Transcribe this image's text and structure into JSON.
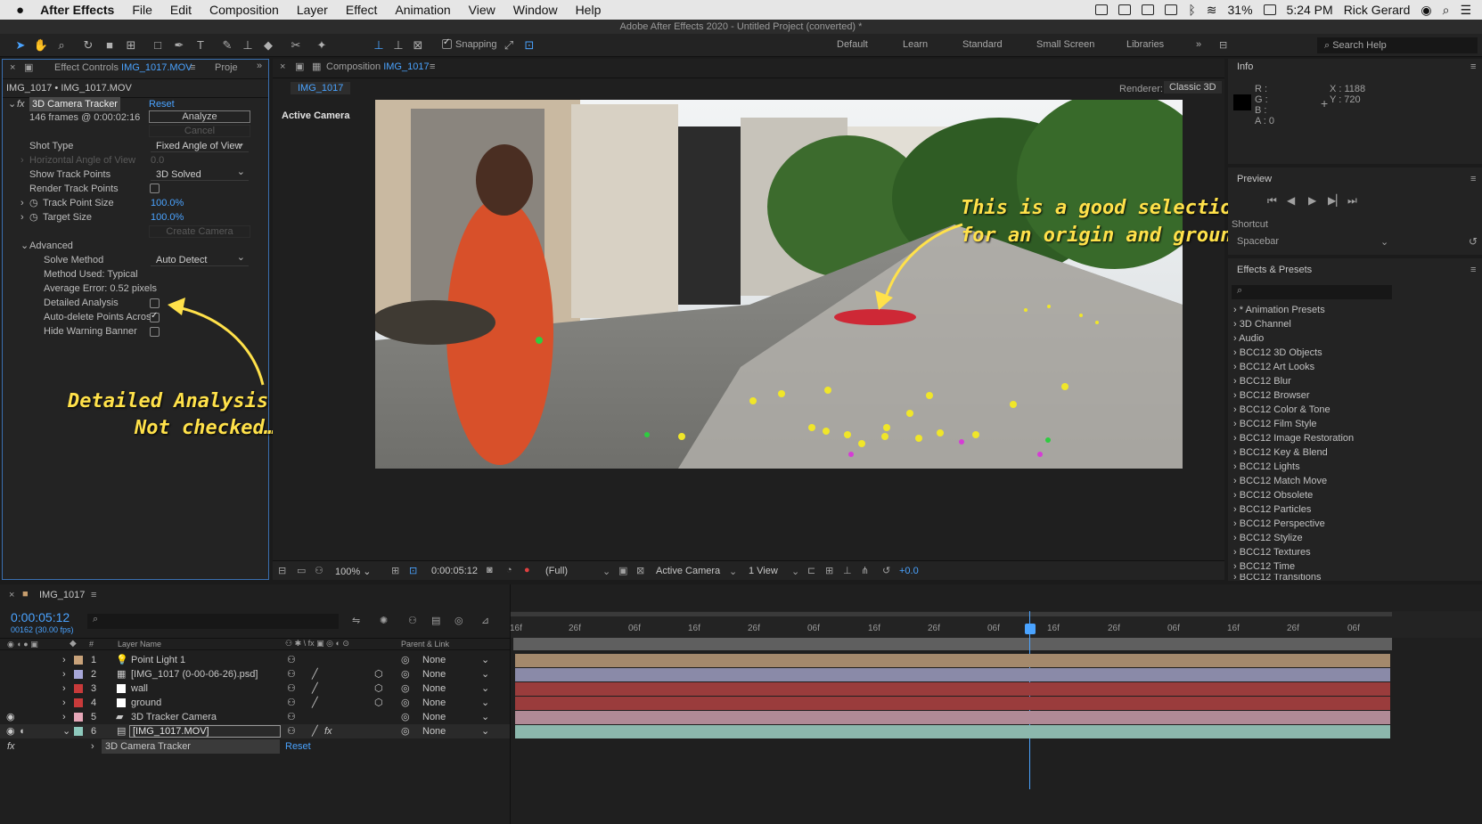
{
  "menubar": {
    "app": "After Effects",
    "items": [
      "File",
      "Edit",
      "Composition",
      "Layer",
      "Effect",
      "Animation",
      "View",
      "Window",
      "Help"
    ],
    "battery": "31%",
    "time": "5:24 PM",
    "user": "Rick Gerard"
  },
  "window_title": "Adobe After Effects 2020 - Untitled Project (converted) *",
  "toolbar": {
    "snapping": "Snapping",
    "workspaces": [
      "Default",
      "Learn",
      "Standard",
      "Small Screen",
      "Libraries"
    ],
    "search_placeholder": "Search Help"
  },
  "effect_controls": {
    "tab_prefix": "Effect Controls",
    "tab_file": "IMG_1017.MOV",
    "tab2": "Proje",
    "header": "IMG_1017 • IMG_1017.MOV",
    "effect_name": "3D Camera Tracker",
    "reset": "Reset",
    "frames_info": "146 frames @ 0:00:02:16",
    "analyze": "Analyze",
    "cancel": "Cancel",
    "shot_type_label": "Shot Type",
    "shot_type_value": "Fixed Angle of View",
    "hav_label": "Horizontal Angle of View",
    "hav_value": "0.0",
    "show_tp_label": "Show Track Points",
    "show_tp_value": "3D Solved",
    "render_tp_label": "Render Track Points",
    "tp_size_label": "Track Point Size",
    "tp_size_value": "100.0%",
    "target_size_label": "Target Size",
    "target_size_value": "100.0%",
    "create_camera": "Create Camera",
    "advanced_label": "Advanced",
    "solve_method_label": "Solve Method",
    "solve_method_value": "Auto Detect",
    "method_used": "Method Used: Typical",
    "avg_error": "Average Error: 0.52 pixels",
    "detailed_label": "Detailed Analysis",
    "autodelete_label": "Auto-delete Points Acros",
    "hide_warning_label": "Hide Warning Banner"
  },
  "composition": {
    "tab_prefix": "Composition",
    "tab_name": "IMG_1017",
    "subtab": "IMG_1017",
    "renderer_label": "Renderer:",
    "renderer_value": "Classic 3D",
    "view_label": "Active Camera",
    "zoom": "100%",
    "timecode": "0:00:05:12",
    "resolution": "(Full)",
    "camera": "Active Camera",
    "views": "1 View",
    "exposure": "+0.0"
  },
  "annotations": {
    "left_line1": "Detailed Analysis",
    "left_line2": "Not checked…",
    "right_line1": "This is a good selection",
    "right_line2": "for an origin and ground plane"
  },
  "info": {
    "title": "Info",
    "r": "R :",
    "g": "G :",
    "b": "B :",
    "a": "A : 0",
    "x": "X : 1188",
    "y": "Y : 720"
  },
  "preview": {
    "title": "Preview",
    "shortcut_label": "Shortcut",
    "shortcut_value": "Spacebar"
  },
  "effects_presets": {
    "title": "Effects & Presets",
    "items": [
      "* Animation Presets",
      "3D Channel",
      "Audio",
      "BCC12 3D Objects",
      "BCC12 Art Looks",
      "BCC12 Blur",
      "BCC12 Browser",
      "BCC12 Color & Tone",
      "BCC12 Film Style",
      "BCC12 Image Restoration",
      "BCC12 Key & Blend",
      "BCC12 Lights",
      "BCC12 Match Move",
      "BCC12 Obsolete",
      "BCC12 Particles",
      "BCC12 Perspective",
      "BCC12 Stylize",
      "BCC12 Textures",
      "BCC12 Time",
      "BCC12 Transitions"
    ]
  },
  "timeline": {
    "tab": "IMG_1017",
    "timecode": "0:00:05:12",
    "fps": "00162 (30.00 fps)",
    "col_num": "#",
    "col_name": "Layer Name",
    "col_parent": "Parent & Link",
    "ruler": [
      "16f",
      "26f",
      "06f",
      "16f",
      "26f",
      "06f",
      "16f",
      "26f",
      "06f",
      "16f",
      "26f",
      "06f",
      "16f",
      "26f",
      "06f"
    ],
    "layers": [
      {
        "num": "1",
        "name": "Point Light 1",
        "parent": "None",
        "color": "#c8a27a"
      },
      {
        "num": "2",
        "name": "[IMG_1017 (0-00-06-26).psd]",
        "parent": "None",
        "color": "#a7a7d8"
      },
      {
        "num": "3",
        "name": "wall",
        "parent": "None",
        "color": "#c83a3a"
      },
      {
        "num": "4",
        "name": "ground",
        "parent": "None",
        "color": "#c83a3a"
      },
      {
        "num": "5",
        "name": "3D Tracker Camera",
        "parent": "None",
        "color": "#e6a7b8"
      },
      {
        "num": "6",
        "name": "[IMG_1017.MOV]",
        "parent": "None",
        "color": "#8ec9bd"
      }
    ],
    "effect_row": "3D Camera Tracker",
    "effect_reset": "Reset"
  },
  "colors": {
    "accent": "#4aa3ff",
    "annotation": "#ffe14a",
    "target": "#d11a2a"
  }
}
